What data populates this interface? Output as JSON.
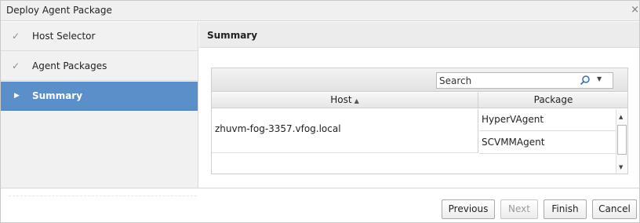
{
  "window": {
    "title": "Deploy Agent Package",
    "close_glyph": "×"
  },
  "sidebar": {
    "items": [
      {
        "label": "Host Selector",
        "state": "completed",
        "icon": "check-icon",
        "glyph": "✓"
      },
      {
        "label": "Agent Packages",
        "state": "completed",
        "icon": "check-icon",
        "glyph": "✓"
      },
      {
        "label": "Summary",
        "state": "active",
        "icon": "arrow-right-icon",
        "glyph": "▶"
      }
    ]
  },
  "main": {
    "heading": "Summary",
    "search": {
      "placeholder": "Search",
      "value": "",
      "icon": "search-icon",
      "dropdown_glyph": "▼"
    },
    "table": {
      "columns": [
        {
          "label": "Host",
          "sort": "ascending",
          "sort_glyph": "▲"
        },
        {
          "label": "Package"
        }
      ],
      "rows": [
        {
          "host": "zhuvm-fog-3357.vfog.local",
          "packages": [
            "HyperVAgent",
            "SCVMMAgent"
          ]
        }
      ],
      "scroll_up_glyph": "▲",
      "scroll_down_glyph": "▼"
    }
  },
  "footer": {
    "buttons": [
      {
        "label": "Previous",
        "enabled": true
      },
      {
        "label": "Next",
        "enabled": false
      },
      {
        "label": "Finish",
        "enabled": true
      },
      {
        "label": "Cancel",
        "enabled": true
      }
    ]
  },
  "colors": {
    "accent": "#5b8fc9",
    "sidebar_bg": "#f1f1f1",
    "header_bg": "#ececec"
  }
}
